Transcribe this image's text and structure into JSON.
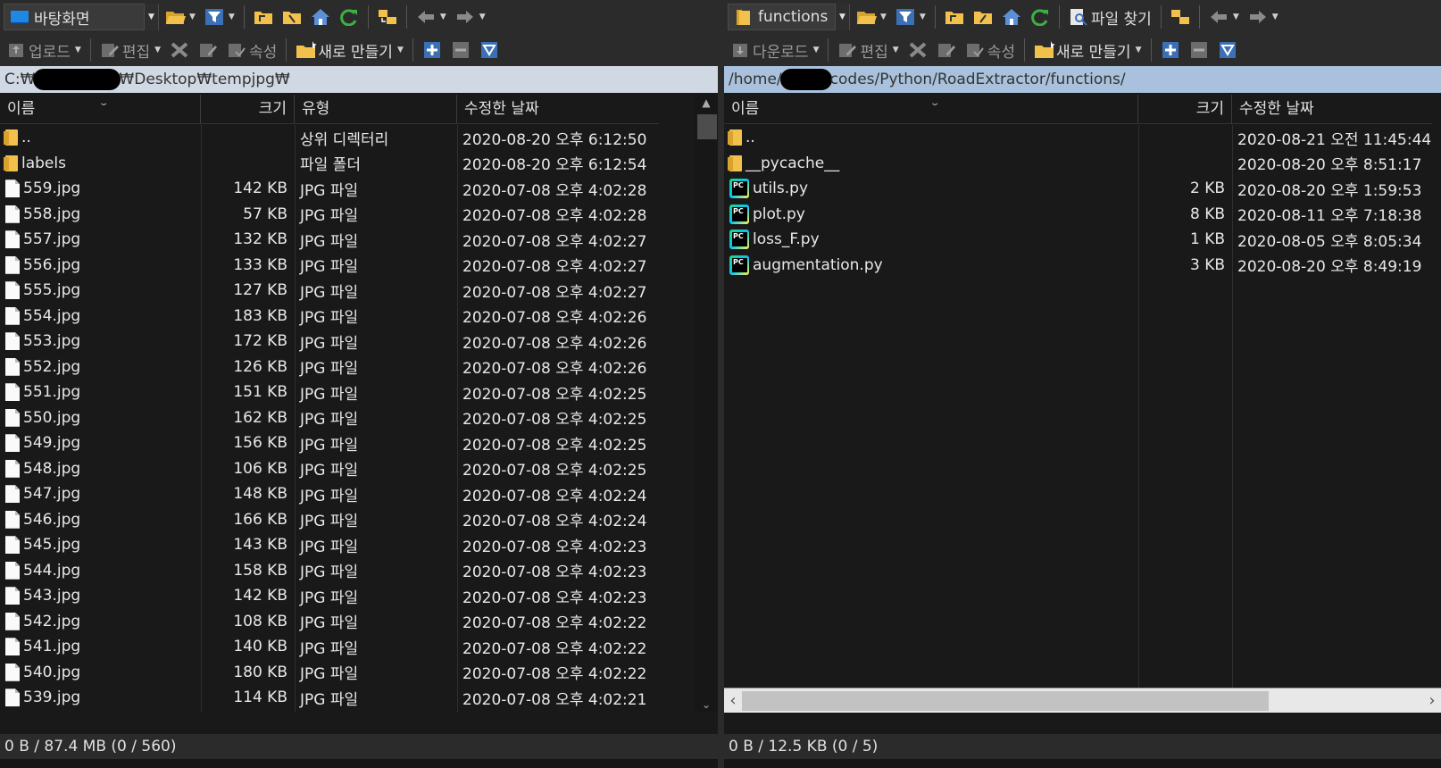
{
  "left": {
    "drive_combo": "바탕화면",
    "toolbar2": {
      "upload": "업로드",
      "edit": "편집",
      "properties": "속성",
      "new": "새로 만들기"
    },
    "path_prefix": "C:₩",
    "path_suffix": "₩Desktop₩tempjpg₩",
    "columns": {
      "name": "이름",
      "size": "크기",
      "type": "유형",
      "modified": "수정한 날짜"
    },
    "rows": [
      {
        "icon": "folder-up",
        "name": "..",
        "size": "",
        "type": "상위 디렉터리",
        "modified": "2020-08-20  오후 6:12:50"
      },
      {
        "icon": "folder",
        "name": "labels",
        "size": "",
        "type": "파일 폴더",
        "modified": "2020-08-20  오후 6:12:54"
      },
      {
        "icon": "file",
        "name": "559.jpg",
        "size": "142 KB",
        "type": "JPG 파일",
        "modified": "2020-07-08  오후 4:02:28"
      },
      {
        "icon": "file",
        "name": "558.jpg",
        "size": "57 KB",
        "type": "JPG 파일",
        "modified": "2020-07-08  오후 4:02:28"
      },
      {
        "icon": "file",
        "name": "557.jpg",
        "size": "132 KB",
        "type": "JPG 파일",
        "modified": "2020-07-08  오후 4:02:27"
      },
      {
        "icon": "file",
        "name": "556.jpg",
        "size": "133 KB",
        "type": "JPG 파일",
        "modified": "2020-07-08  오후 4:02:27"
      },
      {
        "icon": "file",
        "name": "555.jpg",
        "size": "127 KB",
        "type": "JPG 파일",
        "modified": "2020-07-08  오후 4:02:27"
      },
      {
        "icon": "file",
        "name": "554.jpg",
        "size": "183 KB",
        "type": "JPG 파일",
        "modified": "2020-07-08  오후 4:02:26"
      },
      {
        "icon": "file",
        "name": "553.jpg",
        "size": "172 KB",
        "type": "JPG 파일",
        "modified": "2020-07-08  오후 4:02:26"
      },
      {
        "icon": "file",
        "name": "552.jpg",
        "size": "126 KB",
        "type": "JPG 파일",
        "modified": "2020-07-08  오후 4:02:26"
      },
      {
        "icon": "file",
        "name": "551.jpg",
        "size": "151 KB",
        "type": "JPG 파일",
        "modified": "2020-07-08  오후 4:02:25"
      },
      {
        "icon": "file",
        "name": "550.jpg",
        "size": "162 KB",
        "type": "JPG 파일",
        "modified": "2020-07-08  오후 4:02:25"
      },
      {
        "icon": "file",
        "name": "549.jpg",
        "size": "156 KB",
        "type": "JPG 파일",
        "modified": "2020-07-08  오후 4:02:25"
      },
      {
        "icon": "file",
        "name": "548.jpg",
        "size": "106 KB",
        "type": "JPG 파일",
        "modified": "2020-07-08  오후 4:02:25"
      },
      {
        "icon": "file",
        "name": "547.jpg",
        "size": "148 KB",
        "type": "JPG 파일",
        "modified": "2020-07-08  오후 4:02:24"
      },
      {
        "icon": "file",
        "name": "546.jpg",
        "size": "166 KB",
        "type": "JPG 파일",
        "modified": "2020-07-08  오후 4:02:24"
      },
      {
        "icon": "file",
        "name": "545.jpg",
        "size": "143 KB",
        "type": "JPG 파일",
        "modified": "2020-07-08  오후 4:02:23"
      },
      {
        "icon": "file",
        "name": "544.jpg",
        "size": "158 KB",
        "type": "JPG 파일",
        "modified": "2020-07-08  오후 4:02:23"
      },
      {
        "icon": "file",
        "name": "543.jpg",
        "size": "142 KB",
        "type": "JPG 파일",
        "modified": "2020-07-08  오후 4:02:23"
      },
      {
        "icon": "file",
        "name": "542.jpg",
        "size": "108 KB",
        "type": "JPG 파일",
        "modified": "2020-07-08  오후 4:02:22"
      },
      {
        "icon": "file",
        "name": "541.jpg",
        "size": "140 KB",
        "type": "JPG 파일",
        "modified": "2020-07-08  오후 4:02:22"
      },
      {
        "icon": "file",
        "name": "540.jpg",
        "size": "180 KB",
        "type": "JPG 파일",
        "modified": "2020-07-08  오후 4:02:22"
      },
      {
        "icon": "file",
        "name": "539.jpg",
        "size": "114 KB",
        "type": "JPG 파일",
        "modified": "2020-07-08  오후 4:02:21"
      }
    ],
    "status": "0 B / 87.4 MB (0 / 560)"
  },
  "right": {
    "drive_combo": "functions",
    "find_files": "파일 찾기",
    "toolbar2": {
      "download": "다운로드",
      "edit": "편집",
      "properties": "속성",
      "new": "새로 만들기"
    },
    "path_prefix": "/home/",
    "path_suffix": "codes/Python/RoadExtractor/functions/",
    "columns": {
      "name": "이름",
      "size": "크기",
      "modified": "수정한 날짜"
    },
    "rows": [
      {
        "icon": "folder-up",
        "name": "..",
        "size": "",
        "modified": "2020-08-21 오전 11:45:44"
      },
      {
        "icon": "folder",
        "name": "__pycache__",
        "size": "",
        "modified": "2020-08-20 오후 8:51:17"
      },
      {
        "icon": "py",
        "name": "utils.py",
        "size": "2 KB",
        "modified": "2020-08-20 오후 1:59:53"
      },
      {
        "icon": "py",
        "name": "plot.py",
        "size": "8 KB",
        "modified": "2020-08-11 오후 7:18:38"
      },
      {
        "icon": "py",
        "name": "loss_F.py",
        "size": "1 KB",
        "modified": "2020-08-05 오후 8:05:34"
      },
      {
        "icon": "py",
        "name": "augmentation.py",
        "size": "3 KB",
        "modified": "2020-08-20 오후 8:49:19"
      }
    ],
    "status": "0 B / 12.5 KB (0 / 5)"
  },
  "colors": {
    "path_bar_left": "#cfd8e3",
    "path_bar_right": "#a9c1dc",
    "toolbar_bg": "#2b2b2b",
    "list_bg": "#191919"
  }
}
